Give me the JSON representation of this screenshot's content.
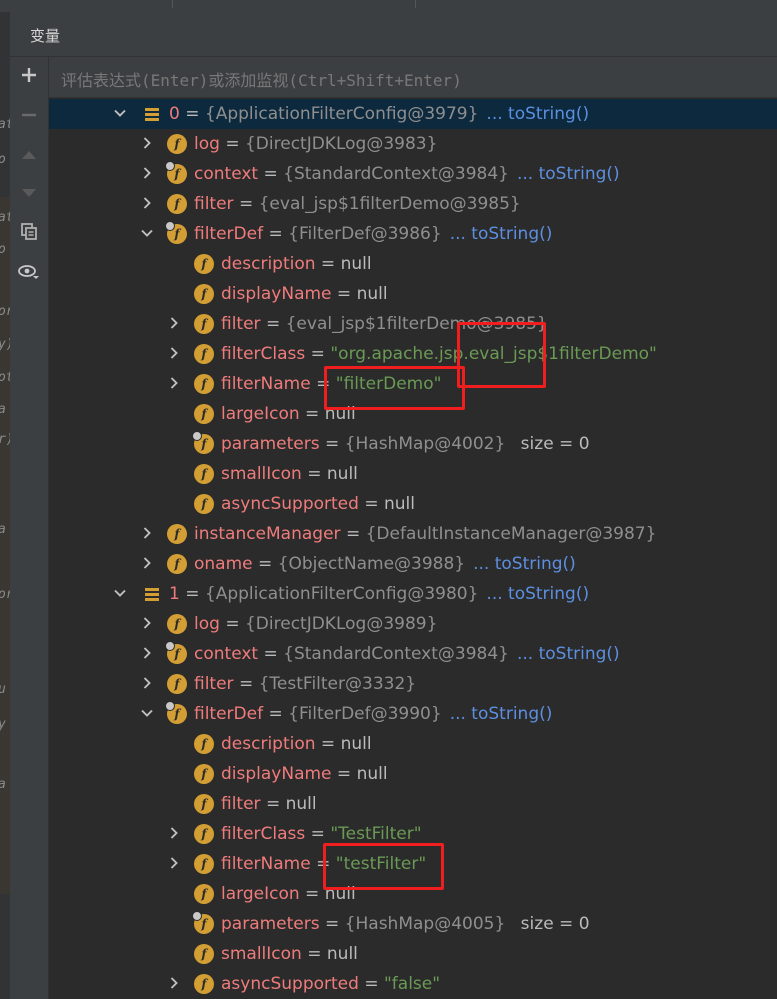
{
  "header": {
    "title": "变量"
  },
  "eval": {
    "placeholder": "评估表达式(Enter)或添加监视(Ctrl+Shift+Enter)"
  },
  "tools": [
    {
      "name": "add-watch-icon"
    },
    {
      "name": "remove-watch-icon"
    },
    {
      "name": "move-up-icon"
    },
    {
      "name": "move-down-icon"
    },
    {
      "name": "copy-icon"
    },
    {
      "name": "view-options-icon"
    }
  ],
  "gutter_letters": [
    "at",
    "o",
    "at",
    "o",
    "or",
    "y)",
    "ot",
    "a",
    "r)",
    "a",
    "or",
    "u",
    "y",
    "a"
  ],
  "colors": {
    "field_icon": "#d39f34",
    "name": "#ef7c7c",
    "string": "#6a9a55",
    "link": "#5c8fe0",
    "highlight": "#f01e1e"
  },
  "rows": [
    {
      "level": 0,
      "arrow": "down",
      "icon": "list",
      "name": "0",
      "value": "{ApplicationFilterConfig@3979}",
      "kind": "obj",
      "link": "... toString()",
      "selected": true
    },
    {
      "level": 1,
      "arrow": "right",
      "icon": "f",
      "name": "log",
      "value": "{DirectJDKLog@3983}",
      "kind": "obj"
    },
    {
      "level": 1,
      "arrow": "right",
      "icon": "fpin",
      "name": "context",
      "value": "{StandardContext@3984}",
      "kind": "obj",
      "link": "... toString()"
    },
    {
      "level": 1,
      "arrow": "right",
      "icon": "f",
      "name": "filter",
      "value": "{eval_jsp$1filterDemo@3985}",
      "kind": "obj"
    },
    {
      "level": 1,
      "arrow": "down",
      "icon": "fpin",
      "name": "filterDef",
      "value": "{FilterDef@3986}",
      "kind": "obj",
      "link": "... toString()"
    },
    {
      "level": 2,
      "arrow": "none",
      "icon": "f",
      "name": "description",
      "value": "null",
      "kind": "null"
    },
    {
      "level": 2,
      "arrow": "none",
      "icon": "f",
      "name": "displayName",
      "value": "null",
      "kind": "null"
    },
    {
      "level": 2,
      "arrow": "right",
      "icon": "f",
      "name": "filter",
      "value": "{eval_jsp$1filterDemo@3985}",
      "kind": "obj"
    },
    {
      "level": 2,
      "arrow": "right",
      "icon": "f",
      "name": "filterClass",
      "value": "\"org.apache.jsp.eval_jsp$1filterDemo\"",
      "kind": "str"
    },
    {
      "level": 2,
      "arrow": "right",
      "icon": "f",
      "name": "filterName",
      "value": "\"filterDemo\"",
      "kind": "str"
    },
    {
      "level": 2,
      "arrow": "none",
      "icon": "f",
      "name": "largeIcon",
      "value": "null",
      "kind": "null"
    },
    {
      "level": 2,
      "arrow": "none",
      "icon": "fpin",
      "name": "parameters",
      "value": "{HashMap@4002}",
      "kind": "obj",
      "extra": "size = 0"
    },
    {
      "level": 2,
      "arrow": "none",
      "icon": "f",
      "name": "smallIcon",
      "value": "null",
      "kind": "null"
    },
    {
      "level": 2,
      "arrow": "none",
      "icon": "f",
      "name": "asyncSupported",
      "value": "null",
      "kind": "null"
    },
    {
      "level": 1,
      "arrow": "right",
      "icon": "f",
      "name": "instanceManager",
      "value": "{DefaultInstanceManager@3987}",
      "kind": "obj"
    },
    {
      "level": 1,
      "arrow": "right",
      "icon": "f",
      "name": "oname",
      "value": "{ObjectName@3988}",
      "kind": "obj",
      "link": "... toString()"
    },
    {
      "level": 0,
      "arrow": "down",
      "icon": "list",
      "name": "1",
      "value": "{ApplicationFilterConfig@3980}",
      "kind": "obj",
      "link": "... toString()"
    },
    {
      "level": 1,
      "arrow": "right",
      "icon": "f",
      "name": "log",
      "value": "{DirectJDKLog@3989}",
      "kind": "obj"
    },
    {
      "level": 1,
      "arrow": "right",
      "icon": "fpin",
      "name": "context",
      "value": "{StandardContext@3984}",
      "kind": "obj",
      "link": "... toString()"
    },
    {
      "level": 1,
      "arrow": "right",
      "icon": "f",
      "name": "filter",
      "value": "{TestFilter@3332}",
      "kind": "obj"
    },
    {
      "level": 1,
      "arrow": "down",
      "icon": "fpin",
      "name": "filterDef",
      "value": "{FilterDef@3990}",
      "kind": "obj",
      "link": "... toString()"
    },
    {
      "level": 2,
      "arrow": "none",
      "icon": "f",
      "name": "description",
      "value": "null",
      "kind": "null"
    },
    {
      "level": 2,
      "arrow": "none",
      "icon": "f",
      "name": "displayName",
      "value": "null",
      "kind": "null"
    },
    {
      "level": 2,
      "arrow": "none",
      "icon": "f",
      "name": "filter",
      "value": "null",
      "kind": "null"
    },
    {
      "level": 2,
      "arrow": "right",
      "icon": "f",
      "name": "filterClass",
      "value": "\"TestFilter\"",
      "kind": "str"
    },
    {
      "level": 2,
      "arrow": "right",
      "icon": "f",
      "name": "filterName",
      "value": "\"testFilter\"",
      "kind": "str"
    },
    {
      "level": 2,
      "arrow": "none",
      "icon": "f",
      "name": "largeIcon",
      "value": "null",
      "kind": "null"
    },
    {
      "level": 2,
      "arrow": "none",
      "icon": "fpin",
      "name": "parameters",
      "value": "{HashMap@4005}",
      "kind": "obj",
      "extra": "size = 0"
    },
    {
      "level": 2,
      "arrow": "none",
      "icon": "f",
      "name": "smallIcon",
      "value": "null",
      "kind": "null"
    },
    {
      "level": 2,
      "arrow": "right",
      "icon": "f",
      "name": "asyncSupported",
      "value": "\"false\"",
      "kind": "str"
    }
  ]
}
